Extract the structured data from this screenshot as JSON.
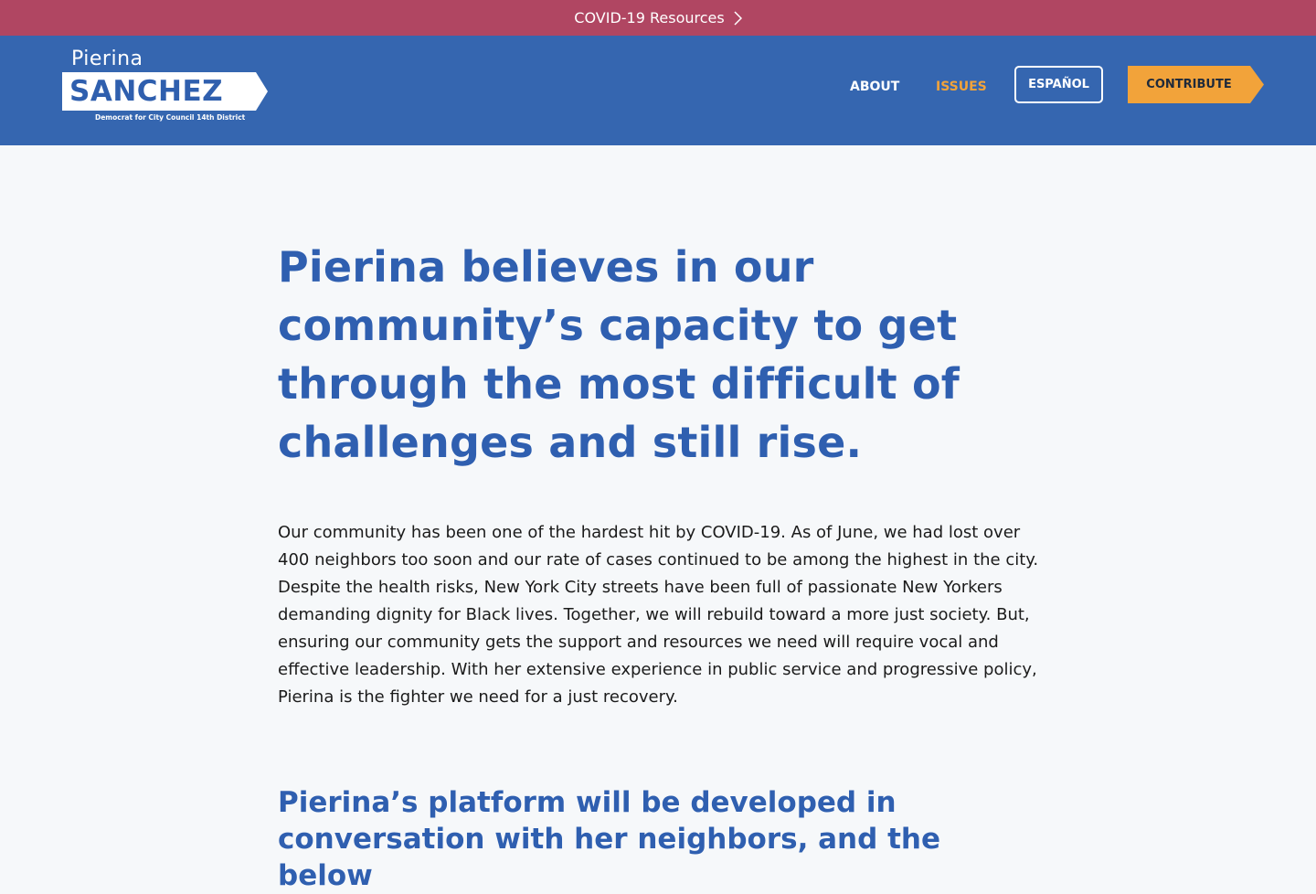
{
  "alert_bar": {
    "label": "COVID-19 Resources",
    "icon": "chevron-right-icon"
  },
  "logo": {
    "first_name": "Pierina",
    "last_name": "SANCHEZ",
    "tagline": "Democrat for City Council 14th District"
  },
  "nav": {
    "about": "ABOUT",
    "issues": "ISSUES",
    "espanol": "ESPAÑOL",
    "contribute": "CONTRIBUTE"
  },
  "main": {
    "headline": "Pierina believes in our community’s capacity to get through the most difficult of challenges and still rise.",
    "intro": "Our community has been one of the hardest hit by COVID-19. As of June, we had lost over 400 neighbors too soon and our rate of cases continued to be among the highest in the city. Despite the health risks, New York City streets have been full of passionate New Yorkers demanding dignity for Black lives. Together, we will rebuild toward a more just society. But, ensuring our community gets the support and resources we need will require vocal and effective leadership. With her extensive experience in public service and progressive policy, Pierina is the fighter we need for a just recovery.",
    "subhead": "Pierina’s platform will be developed in conversation with her neighbors, and the below"
  },
  "colors": {
    "alert_bg": "#b04662",
    "header_bg": "#3566b0",
    "accent_orange": "#f2a33a",
    "heading_blue": "#2f5fb0",
    "page_bg": "#f6f8fa"
  }
}
